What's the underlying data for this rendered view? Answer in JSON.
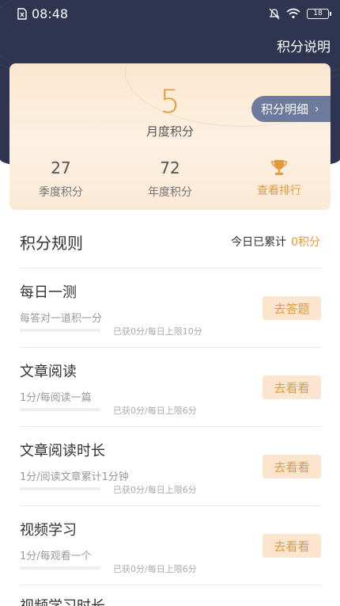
{
  "status": {
    "time": "08:48",
    "battery": "18"
  },
  "nav": {
    "title": "积分说明"
  },
  "card": {
    "month_value": "5",
    "month_label": "月度积分",
    "detail_label": "积分明细",
    "quarter_value": "27",
    "quarter_label": "季度积分",
    "year_value": "72",
    "year_label": "年度积分",
    "rank_label": "查看排行"
  },
  "rules_header": {
    "title": "积分规则",
    "today_label": "今日已累计",
    "today_points": "0积分"
  },
  "rules": [
    {
      "name": "每日一测",
      "desc": "每答对一道积一分",
      "progress": "已获0分/每日上限10分",
      "action": "去答题"
    },
    {
      "name": "文章阅读",
      "desc": "1分/每阅读一篇",
      "progress": "已获0分/每日上限6分",
      "action": "去看看"
    },
    {
      "name": "文章阅读时长",
      "desc": "1分/阅读文章累计1分钟",
      "progress": "已获0分/每日上限6分",
      "action": "去看看"
    },
    {
      "name": "视频学习",
      "desc": "1分/每观看一个",
      "progress": "已获0分/每日上限6分",
      "action": "去看看"
    },
    {
      "name": "视频学习时长"
    }
  ],
  "colors": {
    "header": "#2f3550",
    "accent": "#e39a3b",
    "detail_button": "#6d7a9c"
  }
}
